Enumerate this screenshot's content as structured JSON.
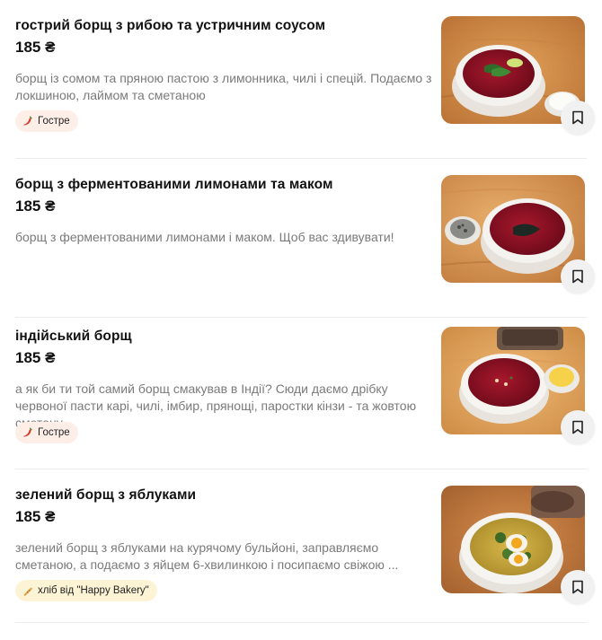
{
  "menu": {
    "items": [
      {
        "title": "гострий борщ з рибою та устричним соусом",
        "price": "185 ₴",
        "description": "борщ із сомом та пряною пастою з лимонника, чилі і спецій. Подаємо з локшиною, лаймом та сметаною",
        "tag": "Гостре",
        "tag_icon": "chili-pepper-icon"
      },
      {
        "title": "борщ з ферментованими лимонами та маком",
        "price": "185 ₴",
        "description": "борщ з ферментованими лимонами і маком. Щоб вас здивувати!"
      },
      {
        "title": "індійський борщ",
        "price": "185 ₴",
        "description": "а як би ти той самий борщ смакував в Індії? Сюди даємо дрібку червоної пасти карі, чилі, імбир, прянощі, паростки кінзи - та жовтою сметану ...",
        "tag": "Гостре",
        "tag_icon": "chili-pepper-icon"
      },
      {
        "title": "зелений борщ з яблуками",
        "price": "185 ₴",
        "description": "зелений борщ з яблуками на курячому бульйоні, заправляємо сметаною, а подаємо з яйцем 6-хвилинкою і посипаємо свіжою ...",
        "tag": "хліб від \"Happy Bakery\"",
        "tag_icon": "bread-icon"
      }
    ]
  },
  "colors": {
    "spicy_tag_bg": "#fdeee8",
    "bread_tag_bg": "#fdf4d6",
    "description_text": "#7a7a7a",
    "bookmark_bg": "#f1f1f1"
  },
  "icons": {
    "bookmark": "bookmark-icon"
  }
}
